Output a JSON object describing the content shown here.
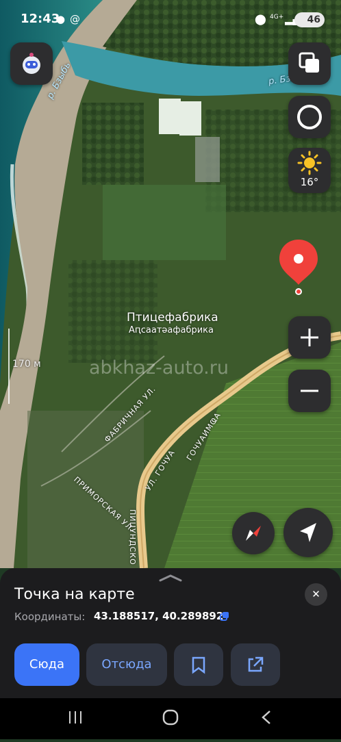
{
  "status_bar": {
    "time": "12:43",
    "signal_text": "4G+",
    "battery": "46"
  },
  "map": {
    "place_name": "Птицефабрика",
    "place_name_local": "Аԥсаатәафабрика",
    "river_label_1": "р. Бзыбь",
    "river_label_2": "р. Бзыбь",
    "scale_label": "170 м",
    "watermark": "abkhaz-auto.ru",
    "streets": {
      "fabrichnaya": "ФАБРИЧНАЯ УЛ.",
      "primorskaya": "ПРИМОРСКАЯ УЛ.",
      "gochua": "УЛ. ГОЧУА",
      "gochuaimfa": "ГОЧУАИМҨА",
      "pitsundskoe": "ПИЦУНДСКО"
    }
  },
  "weather": {
    "temperature": "16°",
    "icon": "sun-icon"
  },
  "sheet": {
    "title": "Точка на карте",
    "coordinates_label": "Координаты:",
    "coordinates_value": "43.188517, 40.289892"
  },
  "actions": {
    "here": "Сюда",
    "from_here": "Отсюда"
  },
  "colors": {
    "accent": "#3b74f7",
    "pin": "#f0413b",
    "road": "#e8c98c"
  }
}
